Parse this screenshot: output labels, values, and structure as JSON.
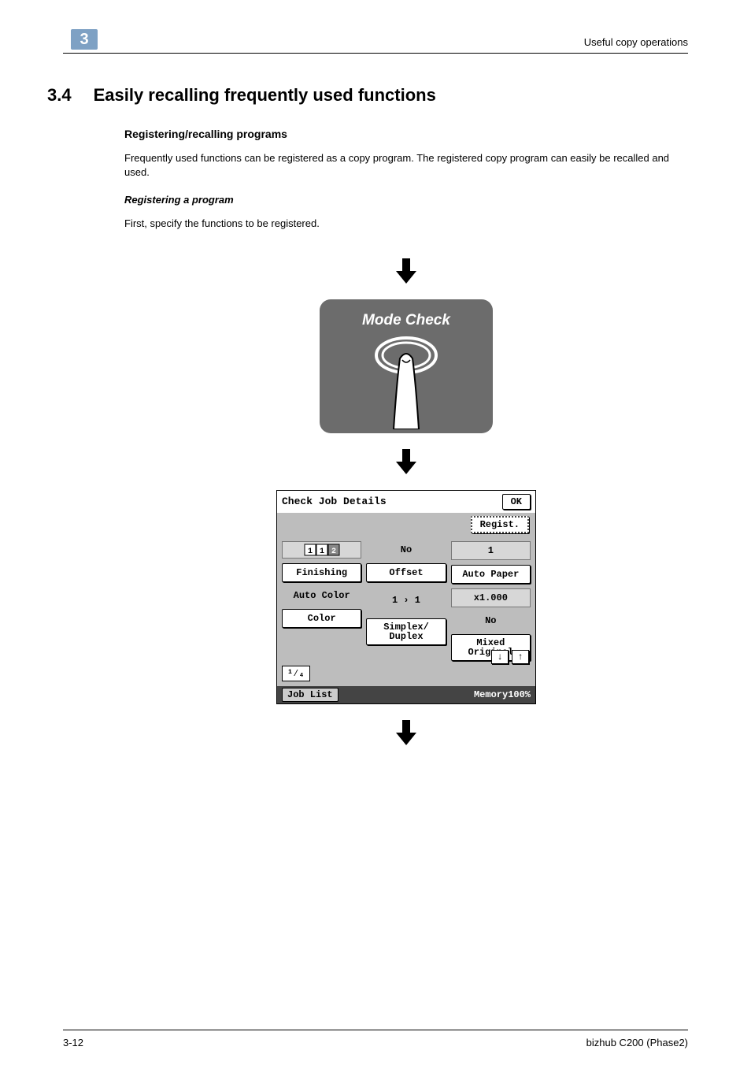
{
  "header": {
    "section_number": "3",
    "running_head": "Useful copy operations"
  },
  "section": {
    "number": "3.4",
    "title": "Easily recalling frequently used functions"
  },
  "subsections": {
    "registering_recalling": "Registering/recalling programs",
    "body1": "Frequently used functions can be registered as a copy program. The registered copy program can easily be recalled and used.",
    "registering_a_program": "Registering a program",
    "body2": "First, specify the functions to be registered."
  },
  "mode_check": {
    "label": "Mode Check"
  },
  "lcd": {
    "title": "Check Job Details",
    "ok_label": "OK",
    "regist_label": "Regist.",
    "col1": {
      "finishing_label": "Finishing",
      "auto_color": "Auto Color",
      "color_label": "Color"
    },
    "col2": {
      "no": "No",
      "offset": "Offset",
      "one_to_one": "1 › 1",
      "simplex_duplex": "Simplex/\nDuplex"
    },
    "col3": {
      "one": "1",
      "auto_paper": "Auto Paper",
      "x1000": "x1.000",
      "no": "No",
      "mixed_original": "Mixed\nOriginal"
    },
    "page_indicator": "¹⁄₄",
    "nav_down": "↓",
    "nav_up": "↑",
    "job_list": "Job List",
    "memory": "Memory100%"
  },
  "footer": {
    "page": "3-12",
    "product": "bizhub C200 (Phase2)"
  }
}
